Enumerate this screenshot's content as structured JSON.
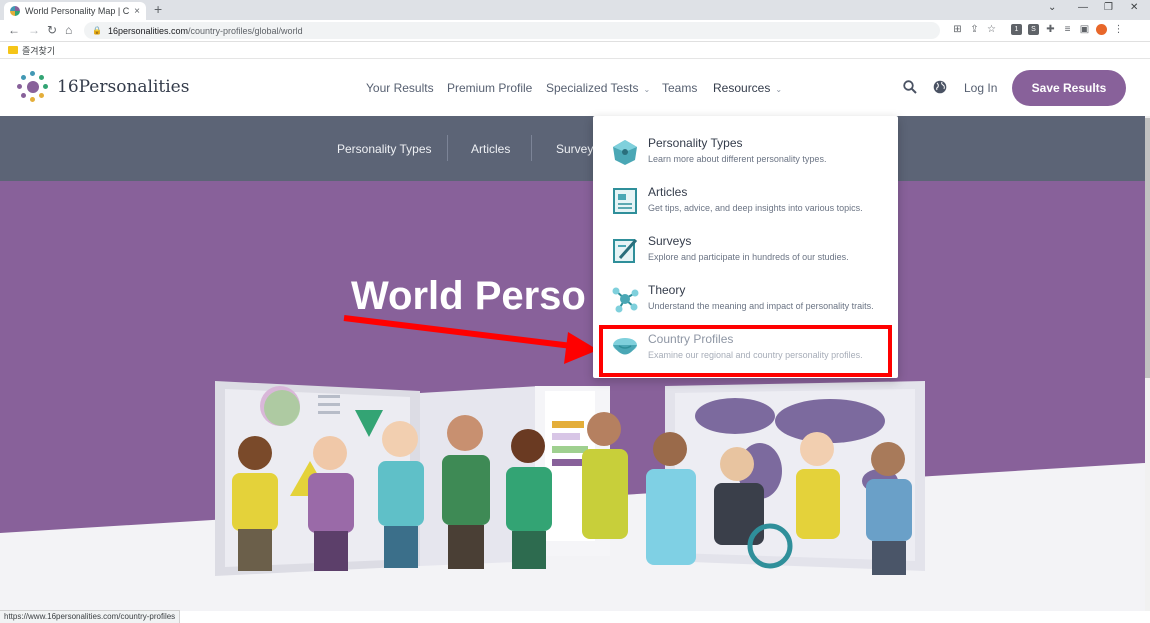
{
  "browser": {
    "tab_title": "World Personality Map | Countr",
    "tab_close": "×",
    "new_tab": "+",
    "url_host": "16personalities.com",
    "url_path": "/country-profiles/global/world",
    "bookmark_label": "즐겨찾기",
    "status_url": "https://www.16personalities.com/country-profiles",
    "ext_icons": [
      "translate-icon",
      "share-icon",
      "star-icon",
      "ext-1",
      "ext-s",
      "puzzle-icon",
      "reading-list-icon",
      "sidebar-icon",
      "profile-icon",
      "menu-icon"
    ]
  },
  "header": {
    "logo_text": "16Personalities",
    "nav": [
      {
        "label": "Your Results"
      },
      {
        "label": "Premium Profile"
      },
      {
        "label": "Specialized Tests"
      },
      {
        "label": "Teams"
      },
      {
        "label": "Resources"
      }
    ],
    "login": "Log In",
    "save_button": "Save Results"
  },
  "subnav": [
    "Personality Types",
    "Articles",
    "Surveys"
  ],
  "hero": {
    "title": "World Perso"
  },
  "dropdown": {
    "items": [
      {
        "title": "Personality Types",
        "desc": "Learn more about different personality types.",
        "icon": "personality-types-icon"
      },
      {
        "title": "Articles",
        "desc": "Get tips, advice, and deep insights into various topics.",
        "icon": "articles-icon"
      },
      {
        "title": "Surveys",
        "desc": "Explore and participate in hundreds of our studies.",
        "icon": "surveys-icon"
      },
      {
        "title": "Theory",
        "desc": "Understand the meaning and impact of personality traits.",
        "icon": "theory-icon"
      },
      {
        "title": "Country Profiles",
        "desc": "Examine our regional and country personality profiles.",
        "icon": "country-profiles-icon"
      }
    ]
  },
  "colors": {
    "brand_purple": "#88619a",
    "subnav_slate": "#5c6476",
    "annotation_red": "#ff0000"
  }
}
